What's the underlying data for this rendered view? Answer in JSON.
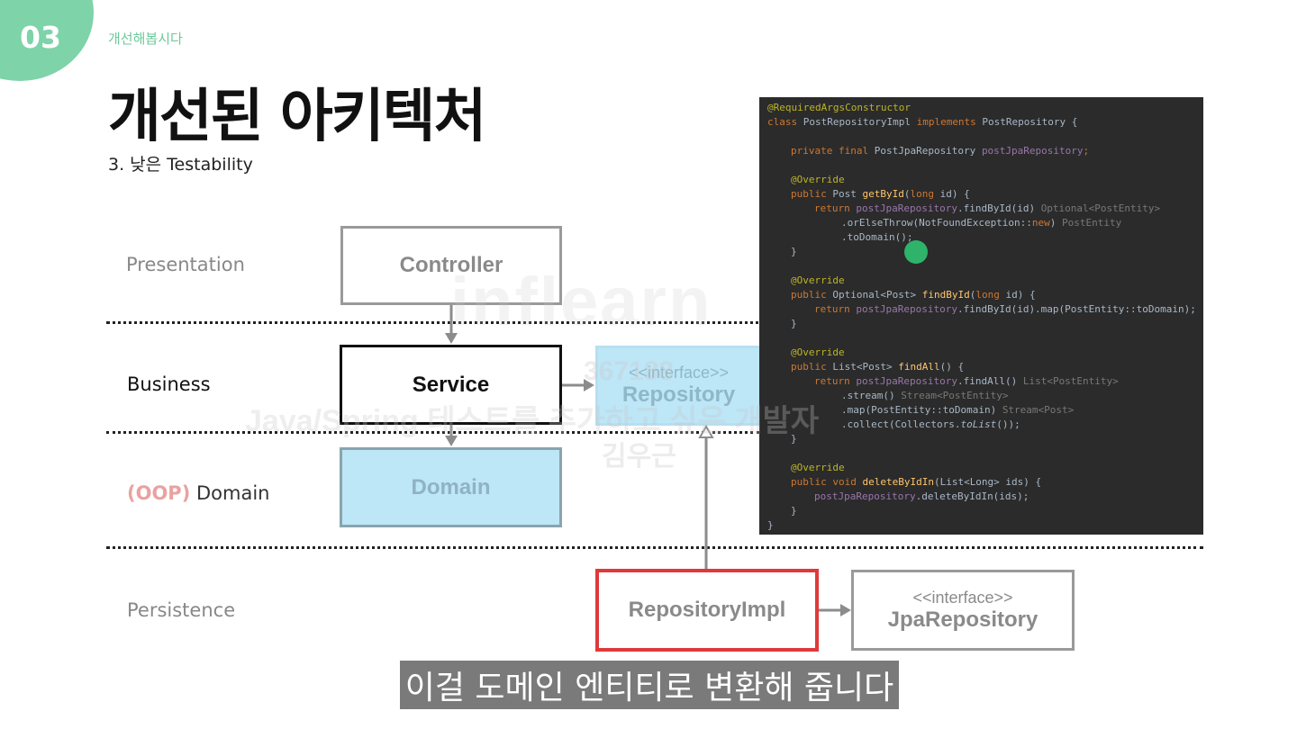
{
  "section": {
    "number": "03",
    "label": "개선해봅시다"
  },
  "slide": {
    "title": "개선된 아키텍처",
    "subtitle": "3. 낮은 Testability"
  },
  "layers": {
    "presentation": "Presentation",
    "business": "Business",
    "domain_prefix": "(OOP)",
    "domain": " Domain",
    "persistence": "Persistence"
  },
  "boxes": {
    "controller": "Controller",
    "service": "Service",
    "repository": {
      "stereotype": "<<interface>>",
      "label": "Repository"
    },
    "domain": "Domain",
    "repository_impl": "RepositoryImpl",
    "jpa_repository": {
      "stereotype": "<<interface>>",
      "label": "JpaRepository"
    }
  },
  "code": {
    "l1": "@RequiredArgsConstructor",
    "l2a": "class",
    "l2b": " PostRepositoryImpl ",
    "l2c": "implements",
    "l2d": " PostRepository {",
    "l3a": "private final",
    "l3b": " PostJpaRepository ",
    "l3c": "postJpaRepository",
    "l3d": ";",
    "ov": "@Override",
    "m1a": "public",
    "m1b": " Post ",
    "m1c": "getById",
    "m1d": "(",
    "m1e": "long",
    "m1f": " id) {",
    "m1r1a": "return",
    "m1r1b": " postJpaRepository",
    "m1r1c": ".findById(id) ",
    "m1r1d": "Optional<PostEntity>",
    "m1r2a": ".orElseThrow(NotFoundException::",
    "m1r2b": "new",
    "m1r2c": ") ",
    "m1r2d": "PostEntity",
    "m1r3": ".toDomain();",
    "close": "}",
    "m2a": "public",
    "m2b": " Optional<Post> ",
    "m2c": "findById",
    "m2d": "(",
    "m2e": "long",
    "m2f": " id) {",
    "m2r1a": "return",
    "m2r1b": " postJpaRepository",
    "m2r1c": ".findById(id).map(PostEntity::toDomain);",
    "m3a": "public",
    "m3b": " List<Post> ",
    "m3c": "findAll",
    "m3d": "() {",
    "m3r1a": "return",
    "m3r1b": " postJpaRepository",
    "m3r1c": ".findAll() ",
    "m3r1d": "List<PostEntity>",
    "m3r2a": ".stream() ",
    "m3r2b": "Stream<PostEntity>",
    "m3r3a": ".map(PostEntity::toDomain) ",
    "m3r3b": "Stream<Post>",
    "m3r4a": ".collect(Collectors.",
    "m3r4b": "toList",
    "m3r4c": "());",
    "m4a": "public void",
    "m4b": " deleteByIdIn",
    "m4c": "(List<Long> ids) {",
    "m4r1a": "postJpaRepository",
    "m4r1b": ".deleteByIdIn(ids);",
    "end": "}"
  },
  "watermark": {
    "brand": "inflearn",
    "id": "367188",
    "course": "Java/Spring 테스트를 추가하고 싶은 개발자",
    "name": "김우근"
  },
  "caption": "이걸 도메인 엔티티로 변환해 줍니다",
  "colors": {
    "accent": "#7ed3a8",
    "highlight_box": "#bde6f7",
    "impl_border": "#e0393b"
  }
}
